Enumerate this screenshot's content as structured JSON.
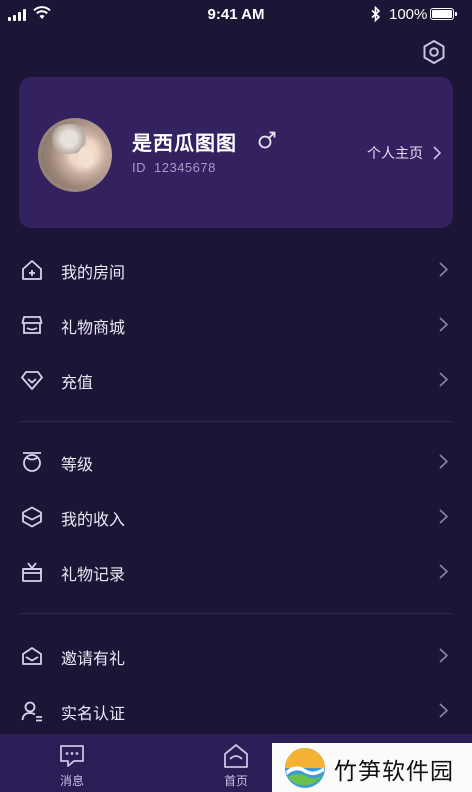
{
  "status_bar": {
    "time": "9:41 AM",
    "battery": "100%"
  },
  "profile": {
    "name": "是西瓜图图",
    "gender_symbol": "♂",
    "id_label": "ID",
    "id_value": "12345678",
    "homepage_label": "个人主页"
  },
  "menu_groups": [
    [
      {
        "label": "我的房间",
        "icon": "house-icon"
      },
      {
        "label": "礼物商城",
        "icon": "store-icon"
      },
      {
        "label": "充值",
        "icon": "diamond-icon"
      }
    ],
    [
      {
        "label": "等级",
        "icon": "level-icon"
      },
      {
        "label": "我的收入",
        "icon": "income-icon"
      },
      {
        "label": "礼物记录",
        "icon": "gift-record-icon"
      }
    ],
    [
      {
        "label": "邀请有礼",
        "icon": "invite-icon"
      },
      {
        "label": "实名认证",
        "icon": "verify-icon"
      }
    ]
  ],
  "tab_bar": [
    {
      "label": "消息",
      "icon": "message-icon"
    },
    {
      "label": "首页",
      "icon": "home-icon"
    }
  ],
  "watermark": {
    "text": "竹笋软件园"
  },
  "colors": {
    "background": "#1d1535",
    "card": "#34215f",
    "tab_bar": "#2b1d56",
    "text": "#ece8f6",
    "muted": "#a79cc6"
  }
}
